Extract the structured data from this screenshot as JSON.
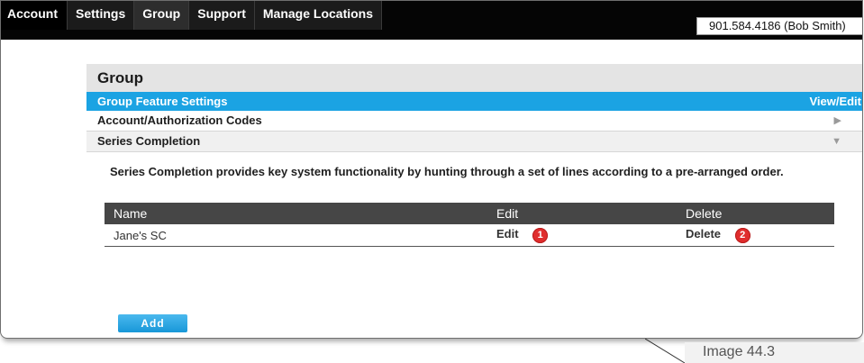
{
  "nav": {
    "items": [
      {
        "label": "Account"
      },
      {
        "label": "Settings"
      },
      {
        "label": "Group"
      },
      {
        "label": "Support"
      },
      {
        "label": "Manage Locations"
      }
    ],
    "active": "Group"
  },
  "user": {
    "label": "901.584.4186 (Bob Smith)"
  },
  "page": {
    "title": "Group"
  },
  "feature_bar": {
    "title": "Group Feature Settings",
    "action": "View/Edit"
  },
  "sections": {
    "account_codes": {
      "label": "Account/Authorization Codes",
      "icon": "collapsed-arrow-icon"
    },
    "series_completion": {
      "label": "Series Completion",
      "icon": "expanded-arrow-icon"
    }
  },
  "series": {
    "description": "Series Completion provides key system functionality by hunting through a set of lines according to a pre-arranged order.",
    "columns": [
      "Name",
      "Edit",
      "Delete"
    ],
    "rows": [
      {
        "name": "Jane's SC",
        "edit": "Edit",
        "edit_badge": "1",
        "delete": "Delete",
        "delete_badge": "2"
      }
    ],
    "add_label": "Add"
  },
  "caption": "Image 44.3",
  "colors": {
    "accent": "#1ba3e3",
    "badge": "#e02d2d",
    "topbar": "#050505"
  }
}
